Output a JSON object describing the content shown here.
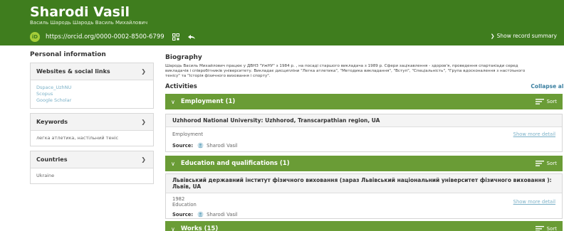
{
  "header": {
    "name": "Sharodi Vasil",
    "also_known_as": "Василь Шародь Шародь Василь Михайлович",
    "orcid_badge": "iD",
    "orcid_url": "https://orcid.org/0000-0002-8500-6799",
    "show_summary": "Show record summary"
  },
  "sidebar": {
    "title": "Personal information",
    "websites": {
      "title": "Websites & social links",
      "links": [
        "Dspace_UzhNU",
        "Scopus",
        "Google Scholar"
      ]
    },
    "keywords": {
      "title": "Keywords",
      "text": "легка атлетика, настільний теніс"
    },
    "countries": {
      "title": "Countries",
      "text": "Ukraine"
    }
  },
  "main": {
    "biography_title": "Biography",
    "biography_text": "Шародь Василь Михайлович працює у ДВНЗ \"УжНУ\" з 1984 р. , на посаді старшого викладача з 1989 р. Сфери зацікавлення - здоров'я, проведення спартакіади серед викладачів і співробітників університету. Викладає дисципліни \"Легка атлетика\", \"Методика викладання\", \"Вступ\", \"Спеціальність\", \"Група вдосконалення з настільного тенісу\" та \"Історія фізичного виховання і спорту\".",
    "activities_title": "Activities",
    "collapse_all": "Collapse all",
    "sort_label": "Sort",
    "source_label": "Source:",
    "show_more": "Show more detail",
    "employment": {
      "title": "Employment (1)",
      "org": "Uzhhorod National University: Uzhhorod, Transcarpathian region, UA",
      "type": "Employment",
      "source_name": "Sharodi Vasil"
    },
    "education": {
      "title": "Education and qualifications (1)",
      "org": "Львівський державний інститут фізичного виховання (зараз Львівський національний університет фізичного виховання ): Львів, UA",
      "year": "1982",
      "type": "Education",
      "source_name": "Sharodi Vasil"
    },
    "works": {
      "title": "Works (15)"
    }
  },
  "colors": {
    "header": "#3f7d1e",
    "section_bar": "#6a9c36",
    "orcid_badge": "#a6ce39",
    "link": "#7ab0c7"
  },
  "icons": [
    "orcid-id-icon",
    "qr-code-icon",
    "share-icon",
    "chevron-right-icon",
    "chevron-down-icon",
    "sort-icon",
    "source-user-icon"
  ]
}
